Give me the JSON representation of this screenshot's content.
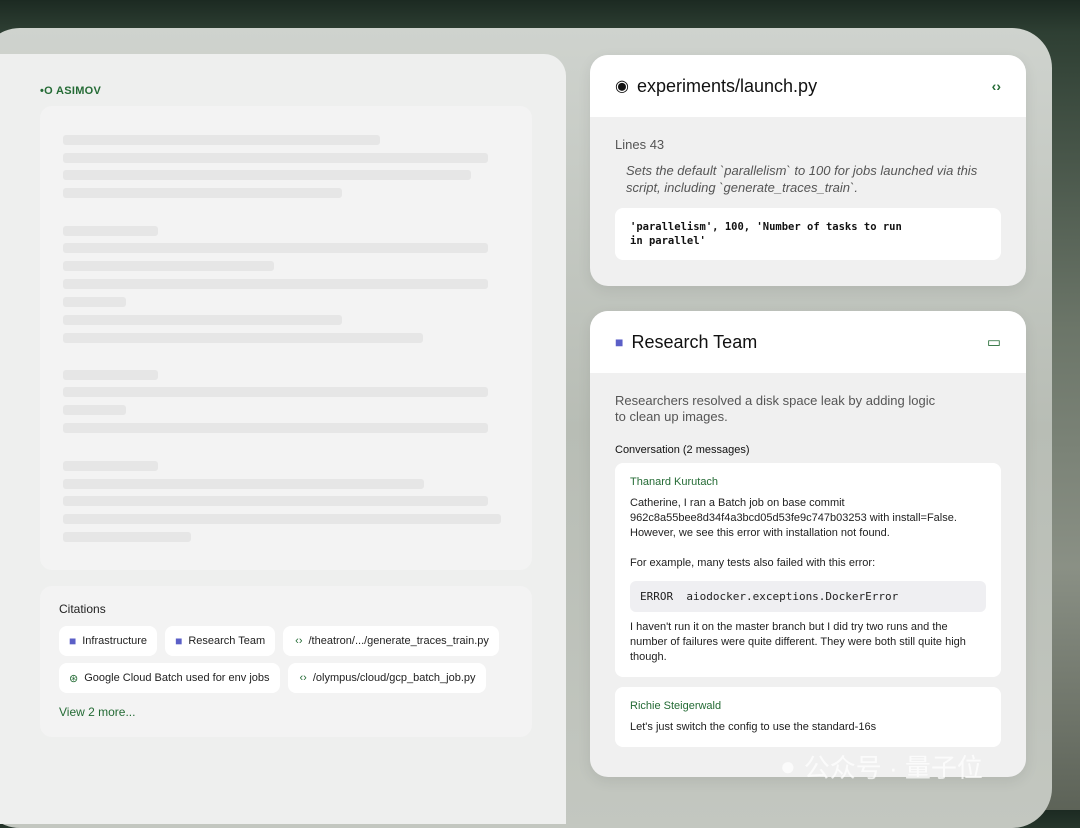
{
  "brand": {
    "logo": "•O ASIMOV"
  },
  "citations": {
    "title": "Citations",
    "items": [
      {
        "icon": "teams-icon",
        "label": "Infrastructure"
      },
      {
        "icon": "teams-icon",
        "label": "Research Team"
      },
      {
        "icon": "code-icon",
        "label": "/theatron/.../generate_traces_train.py"
      },
      {
        "icon": "brain-icon",
        "label": "Google Cloud Batch used for env jobs"
      },
      {
        "icon": "code-icon",
        "label": "/olympus/cloud/gcp_batch_job.py"
      }
    ],
    "more": "View 2 more..."
  },
  "code_card": {
    "title": "experiments/launch.py",
    "lines": "Lines 43",
    "summary": "Sets the default `parallelism` to 100 for jobs launched via this script, including `generate_traces_train`.",
    "snippet_1": "'parallelism', 100, 'Number of tasks to run",
    "snippet_2": "in parallel'"
  },
  "team_card": {
    "title": "Research Team",
    "summary": "Researchers resolved a disk space leak by adding logic to clean up images.",
    "conversation_label": "Conversation (2 messages)",
    "messages": [
      {
        "author": "Thanard Kurutach",
        "text1": "Catherine, I ran a Batch job on base commit 962c8a55bee8d34f4a3bcd05d53fe9c747b03253 with install=False. However, we see this error with installation not found.",
        "text2": "For example, many tests also failed with this error:",
        "error": "ERROR  aiodocker.exceptions.DockerError",
        "text3": "I haven't run it on the master branch but I did try two runs and the number of failures were quite different. They were both still quite high though."
      },
      {
        "author": "Richie Steigerwald",
        "text1": "Let's just switch the config to use the standard-16s"
      }
    ]
  },
  "watermark": "公众号 · 量子位",
  "colors": {
    "accent": "#246b35",
    "teams": "#5b5fc7"
  }
}
